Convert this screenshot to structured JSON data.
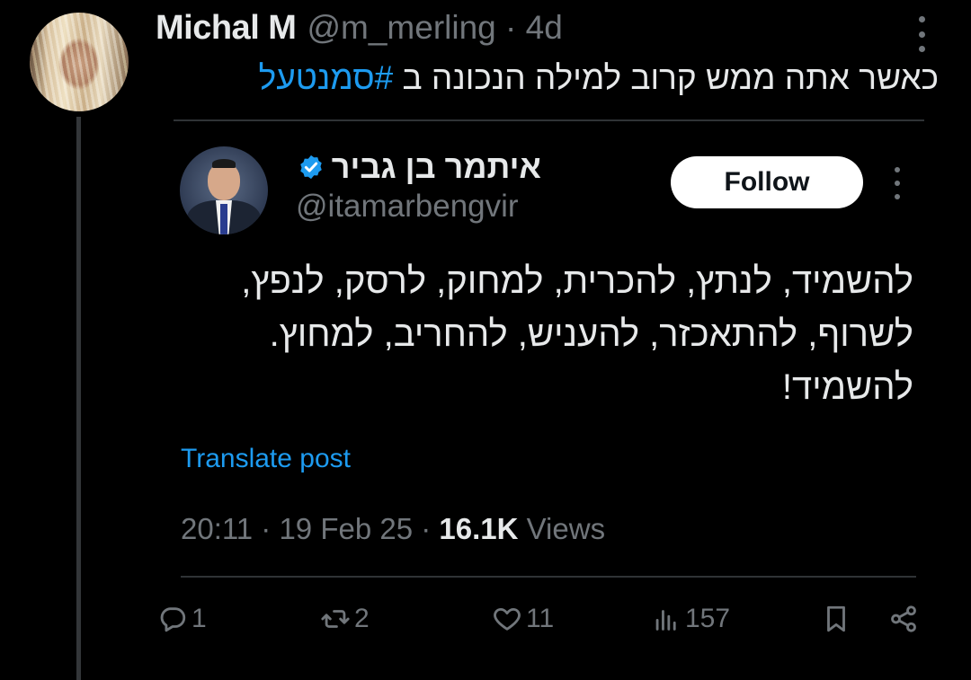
{
  "tweet": {
    "author_name": "Michal M",
    "handle_time": "@m_merling · 4d",
    "text_main": "כאשר אתה ממש קרוב למילה הנכונה ב ",
    "hashtag": "#סמנטעל"
  },
  "quote": {
    "author_name": "איתמר בן גביר",
    "handle": "@itamarbengvir",
    "follow_label": "Follow",
    "body_lines": [
      "להשמיד, לנתץ, להכרית, למחוק, לרסק, לנפץ,",
      "לשרוף, להתאכזר, להעניש, להחריב, למחוץ.",
      "להשמיד!"
    ],
    "translate_label": "Translate post",
    "time_date": "20:11 · 19 Feb 25 · ",
    "views_count": "16.1K",
    "views_label": " Views"
  },
  "actions": {
    "replies": "1",
    "reposts": "2",
    "likes": "11",
    "views": "157"
  },
  "colors": {
    "background": "#000000",
    "text": "#e7e9ea",
    "muted": "#71767b",
    "accent": "#1d9bf0",
    "divider": "#2f3336"
  },
  "icons": [
    "more-vertical-icon",
    "verified-badge-icon",
    "reply-icon",
    "repost-icon",
    "like-icon",
    "views-icon",
    "bookmark-icon",
    "share-icon"
  ]
}
